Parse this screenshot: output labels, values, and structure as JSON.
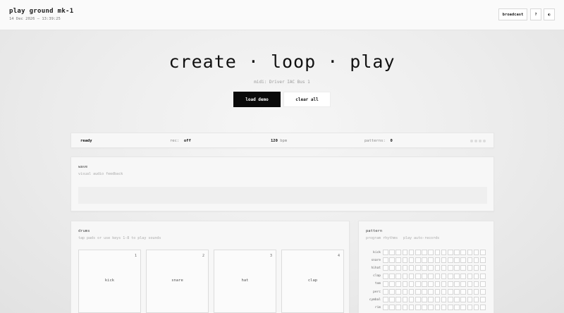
{
  "header": {
    "title": "play ground mk-1",
    "datetime": "14 Dec 2026 — 13:39:25",
    "buttons": {
      "broadcast": "broadcast",
      "help": "?",
      "theme": "◐"
    }
  },
  "hero": {
    "title": "create · loop · play",
    "midi": "midi: Driver IAC Bus 1",
    "load_demo": "load demo",
    "clear_all": "clear all"
  },
  "status": {
    "state": "ready",
    "rec_label": "rec:",
    "rec_value": "off",
    "bpm_value": "120",
    "bpm_unit": "bpm",
    "patterns_label": "patterns:",
    "patterns_value": "0"
  },
  "wave": {
    "title": "wave",
    "subtitle": "visual audio feedback"
  },
  "drums": {
    "title": "drums",
    "subtitle": "tap pads or use keys 1-8 to play sounds",
    "pads": [
      {
        "num": "1",
        "name": "kick"
      },
      {
        "num": "2",
        "name": "snare"
      },
      {
        "num": "3",
        "name": "hat"
      },
      {
        "num": "4",
        "name": "clap"
      }
    ]
  },
  "pattern": {
    "title": "pattern",
    "tabs": [
      "program rhythms",
      "play auto-records"
    ],
    "rows": [
      "kick",
      "snare",
      "hihat",
      "clap",
      "tom",
      "perc",
      "cymbal",
      "rim"
    ],
    "steps": 16
  }
}
